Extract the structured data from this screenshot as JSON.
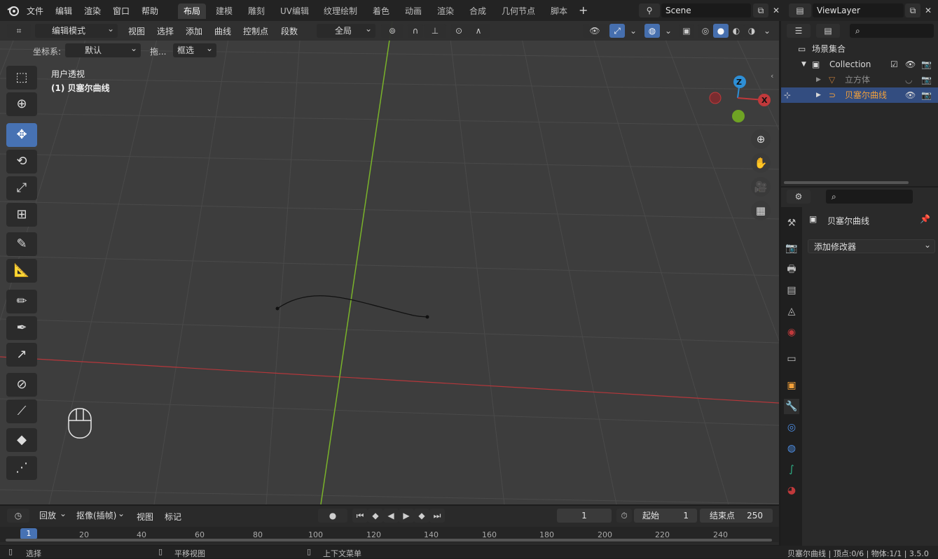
{
  "topbar": {
    "menus": [
      "文件",
      "编辑",
      "渲染",
      "窗口",
      "帮助"
    ],
    "workspaces": [
      "布局",
      "建模",
      "雕刻",
      "UV编辑",
      "纹理绘制",
      "着色",
      "动画",
      "渲染",
      "合成",
      "几何节点",
      "脚本"
    ],
    "active_workspace": "布局",
    "add_label": "+",
    "scene": "Scene",
    "view_layer": "ViewLayer"
  },
  "viewport_header": {
    "mode": "编辑模式",
    "menus": [
      "视图",
      "选择",
      "添加",
      "曲线",
      "控制点",
      "段数"
    ],
    "transform_orientation": "全局",
    "coord_label": "坐标系:",
    "coord_value": "默认",
    "drag_label": "拖...",
    "select_mode": "框选"
  },
  "overlay": {
    "view_name": "用户透视",
    "object_name": "(1) 贝塞尔曲线"
  },
  "gizmo": {
    "z": "Z",
    "x": "X"
  },
  "timeline": {
    "playback": "回放",
    "keying": "抠像(插帧)",
    "view": "视图",
    "marker": "标记",
    "current_frame": "1",
    "start_label": "起始",
    "start_value": "1",
    "end_label": "结束点",
    "end_value": "250",
    "ruler": [
      "1",
      "20",
      "40",
      "60",
      "80",
      "100",
      "120",
      "140",
      "160",
      "180",
      "200",
      "220",
      "240"
    ]
  },
  "statusbar": {
    "select": "选择",
    "pan": "平移视图",
    "context": "上下文菜单",
    "info": "贝塞尔曲线 | 顶点:0/6 | 物体:1/1 | 3.5.0"
  },
  "outliner": {
    "scene_collection": "场景集合",
    "collection": "Collection",
    "items": [
      {
        "name": "立方体",
        "selected": false
      },
      {
        "name": "贝塞尔曲线",
        "selected": true
      }
    ]
  },
  "properties": {
    "object_name": "贝塞尔曲线",
    "add_modifier": "添加修改器"
  },
  "colors": {
    "accent": "#4772b3",
    "x_axis": "#c0393b",
    "y_axis": "#7fb82a",
    "z_axis": "#2e8fd6",
    "selected_text": "#f2a03a"
  }
}
